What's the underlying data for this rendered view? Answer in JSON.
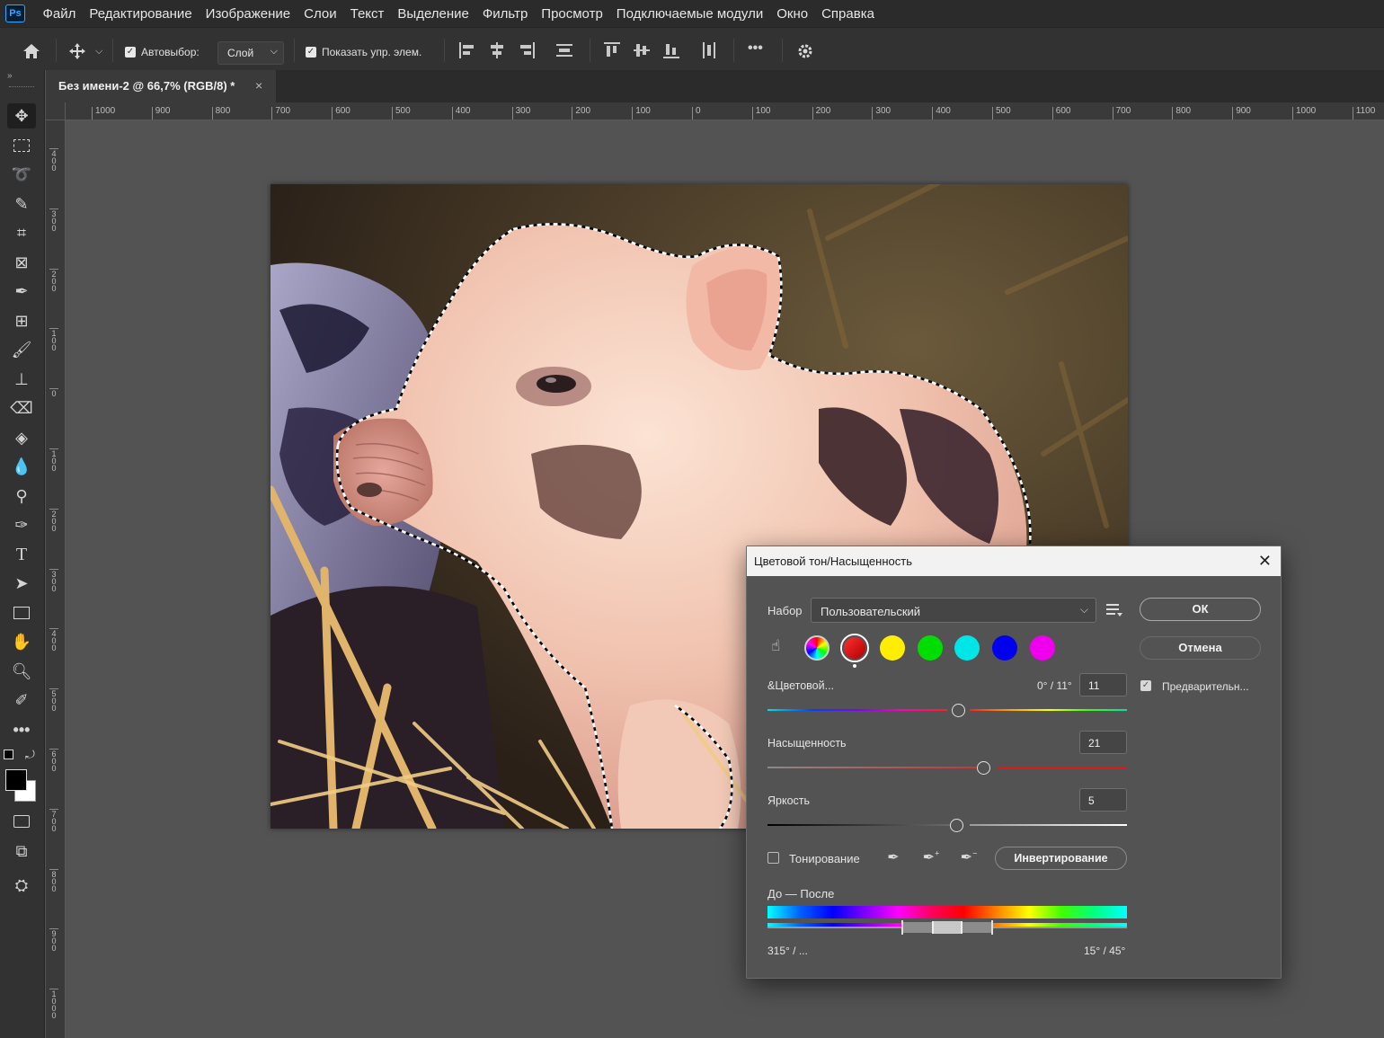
{
  "app": {
    "logo": "Ps"
  },
  "menu": [
    "Файл",
    "Редактирование",
    "Изображение",
    "Слои",
    "Текст",
    "Выделение",
    "Фильтр",
    "Просмотр",
    "Подключаемые модули",
    "Окно",
    "Справка"
  ],
  "options": {
    "autoselect_label": "Автовыбор:",
    "layer_value": "Слой",
    "show_controls_label": "Показать упр. элем.",
    "more_icon": "•••"
  },
  "document": {
    "tab_title": "Без имени-2 @ 66,7% (RGB/8) *",
    "close_glyph": "×"
  },
  "ruler_top": [
    "1000",
    "900",
    "800",
    "700",
    "600",
    "500",
    "400",
    "300",
    "200",
    "100",
    "0",
    "100",
    "200",
    "300",
    "400",
    "500",
    "600",
    "700",
    "800",
    "900",
    "1000",
    "1100"
  ],
  "ruler_left": [
    "4\n0\n0",
    "3\n0\n0",
    "2\n0\n0",
    "1\n0\n0",
    "0",
    "1\n0\n0",
    "2\n0\n0",
    "3\n0\n0",
    "4\n0\n0",
    "5\n0\n0",
    "6\n0\n0",
    "7\n0\n0",
    "8\n0\n0",
    "9\n0\n0",
    "1\n0\n0\n0"
  ],
  "dialog": {
    "title": "Цветовой тон/Насыщенность",
    "close_glyph": "✕",
    "preset_label": "Набор",
    "preset_value": "Пользовательский",
    "ok_label": "ОК",
    "cancel_label": "Отмена",
    "preview_label": "Предварительн...",
    "hue_label": "&Цветовой...",
    "hue_range": "0° / 11°",
    "hue_value": "11",
    "saturation_label": "Насыщенность",
    "saturation_value": "21",
    "lightness_label": "Яркость",
    "lightness_value": "5",
    "colorize_label": "Тонирование",
    "invert_label": "Инвертирование",
    "before_after_label": "До — После",
    "range_left": "315° / ...",
    "range_right": "15° / 45°",
    "swatches": [
      "#ff0000",
      "#ffee00",
      "#00dd00",
      "#00e6e6",
      "#0000ee",
      "#ee00ee"
    ]
  }
}
